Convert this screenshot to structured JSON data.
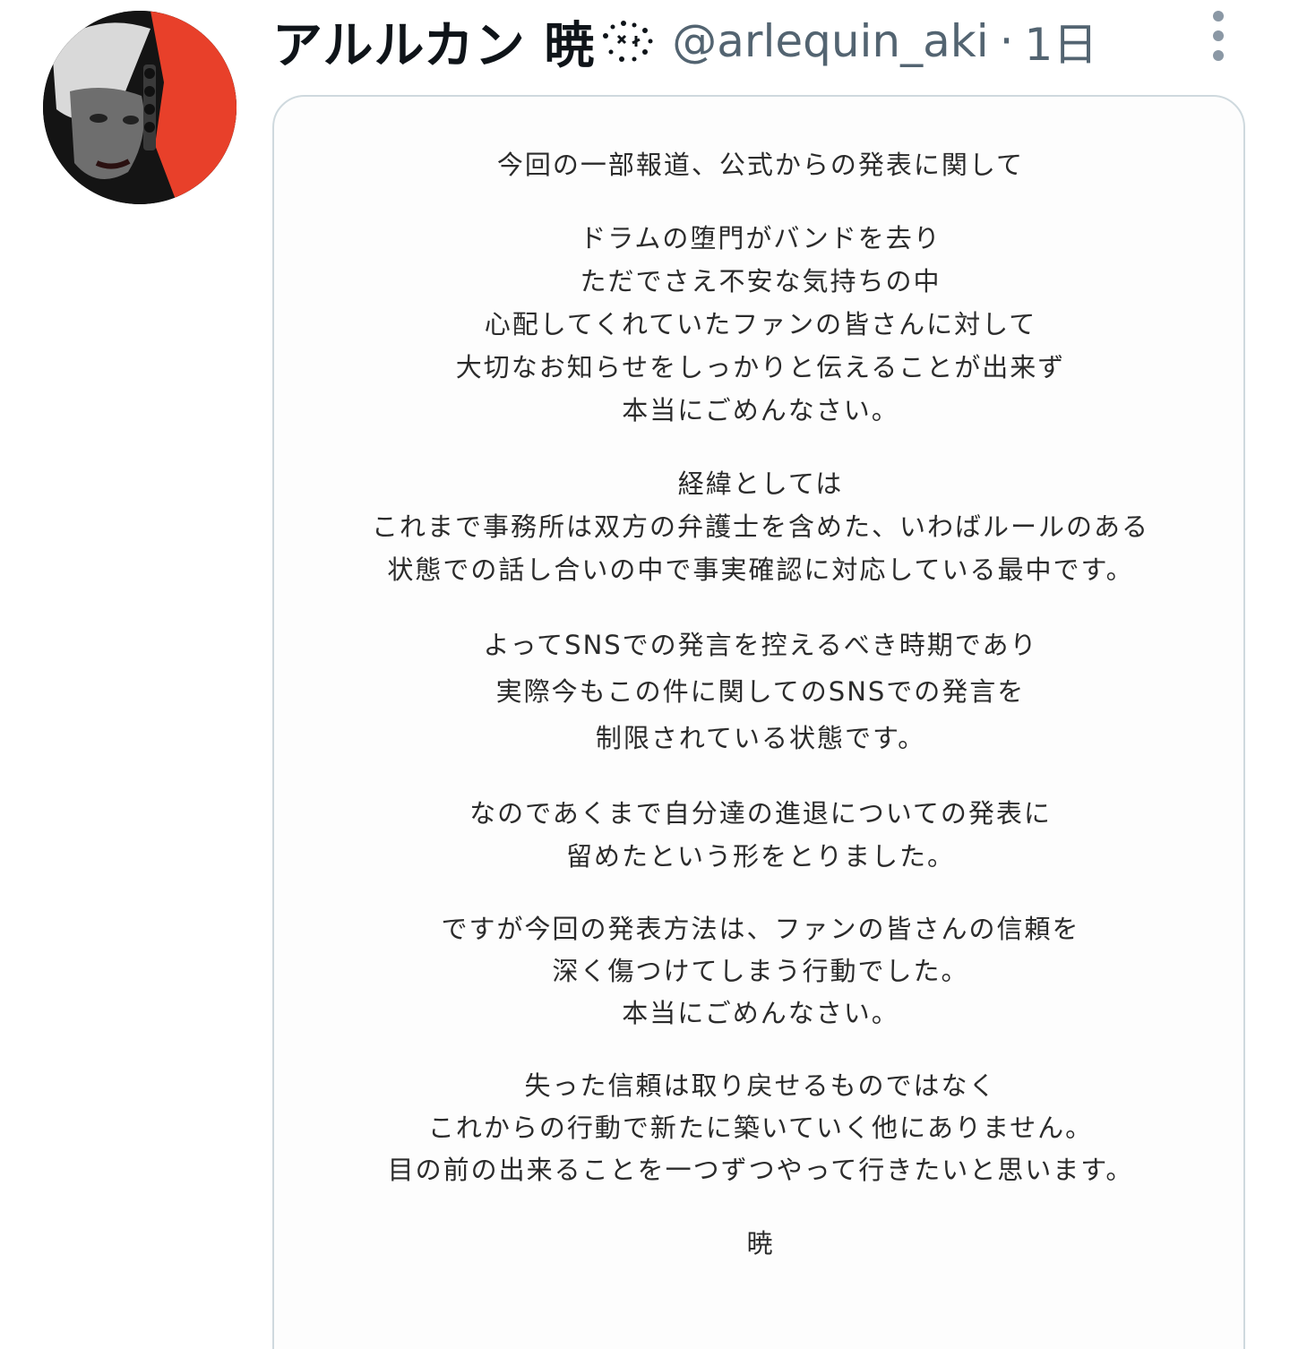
{
  "user": {
    "display_name": "アルルカン 暁",
    "handle": "@arlequin_aki",
    "separator": "·",
    "timestamp": "1日"
  },
  "colors": {
    "text_primary": "#0f1419",
    "text_secondary": "#536471",
    "card_border": "#cfd9de",
    "avatar_accent": "#e8402a"
  },
  "icons": {
    "more": "more-vertical-icon",
    "name_emoji": "sparkle-emoji-icon"
  },
  "statement": {
    "stanzas": [
      [
        "今回の一部報道、公式からの発表に関して"
      ],
      [
        "ドラムの堕門がバンドを去り",
        "ただでさえ不安な気持ちの中",
        "心配してくれていたファンの皆さんに対して",
        "大切なお知らせをしっかりと伝えることが出来ず",
        "本当にごめんなさい。"
      ],
      [
        "経緯としては",
        "これまで事務所は双方の弁護士を含めた、いわばルールのある",
        "状態での話し合いの中で事実確認に対応している最中です。"
      ],
      [
        "よってSNSでの発言を控えるべき時期であり",
        "実際今もこの件に関してのSNSでの発言を",
        "制限されている状態です。"
      ],
      [
        "なのであくまで自分達の進退についての発表に",
        "留めたという形をとりました。"
      ],
      [
        "ですが今回の発表方法は、ファンの皆さんの信頼を",
        "深く傷つけてしまう行動でした。",
        "本当にごめんなさい。"
      ],
      [
        "失った信頼は取り戻せるものではなく",
        "これからの行動で新たに築いていく他にありません。",
        "目の前の出来ることを一つずつやって行きたいと思います。"
      ]
    ],
    "signature": "暁"
  }
}
